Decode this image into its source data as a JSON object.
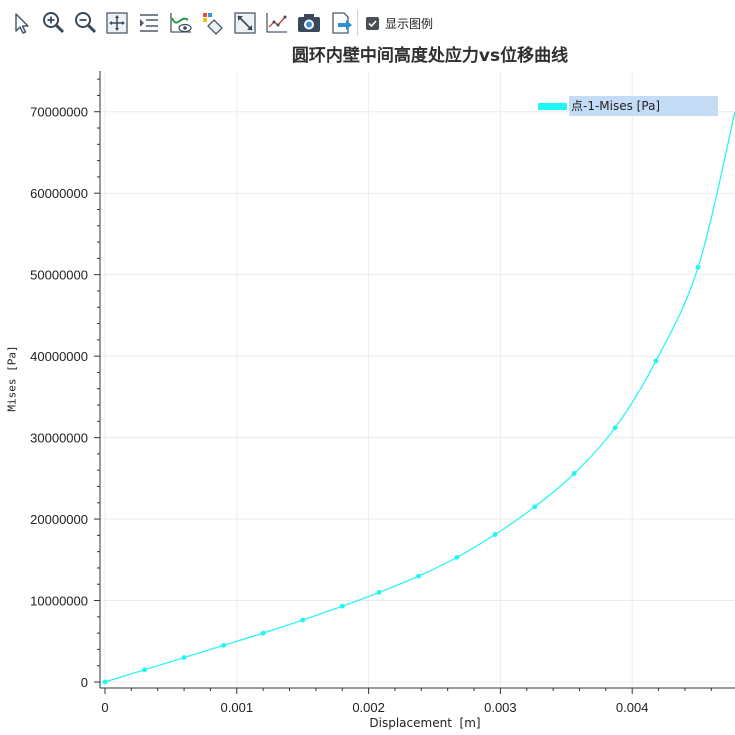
{
  "toolbar": {
    "buttons": [
      {
        "name": "select-pointer-icon"
      },
      {
        "name": "zoom-in-icon"
      },
      {
        "name": "zoom-out-icon"
      },
      {
        "name": "pan-icon"
      },
      {
        "name": "list-icon"
      },
      {
        "name": "curve-visibility-icon"
      },
      {
        "name": "data-filter-icon"
      },
      {
        "name": "fit-view-icon"
      },
      {
        "name": "line-chart-icon"
      },
      {
        "name": "camera-icon"
      },
      {
        "name": "export-icon"
      }
    ],
    "show_legend_label": "显示图例",
    "show_legend_checked": true
  },
  "chart_data": {
    "type": "line",
    "title": "圆环内壁中间高度处应力vs位移曲线",
    "xlabel": "Displacement  [m]",
    "ylabel": "Mises [Pa]",
    "xlim": [
      0,
      0.00478
    ],
    "ylim": [
      0,
      75000000
    ],
    "x_ticks": [
      "0",
      "0.001",
      "0.002",
      "0.003",
      "0.004"
    ],
    "y_ticks": [
      "0",
      "10000000",
      "20000000",
      "30000000",
      "40000000",
      "50000000",
      "60000000",
      "70000000"
    ],
    "grid": true,
    "legend_position": "top-right",
    "series": [
      {
        "name": "点-1-Mises [Pa]",
        "color": "#1ef5f5",
        "x": [
          0,
          0.0003,
          0.0006,
          0.0009,
          0.0012,
          0.0015,
          0.0018,
          0.00208,
          0.00238,
          0.00267,
          0.00296,
          0.00326,
          0.00356,
          0.00387,
          0.00418,
          0.0045,
          0.00478
        ],
        "y": [
          0,
          1500000,
          3000000,
          4500000,
          6000000,
          7600000,
          9300000,
          11000000,
          13000000,
          15300000,
          18100000,
          21500000,
          25600000,
          31200000,
          39400000,
          50900000,
          70000000
        ],
        "markers": [
          true,
          true,
          true,
          true,
          true,
          true,
          true,
          true,
          true,
          true,
          true,
          true,
          true,
          true,
          true,
          true,
          false
        ]
      }
    ]
  }
}
